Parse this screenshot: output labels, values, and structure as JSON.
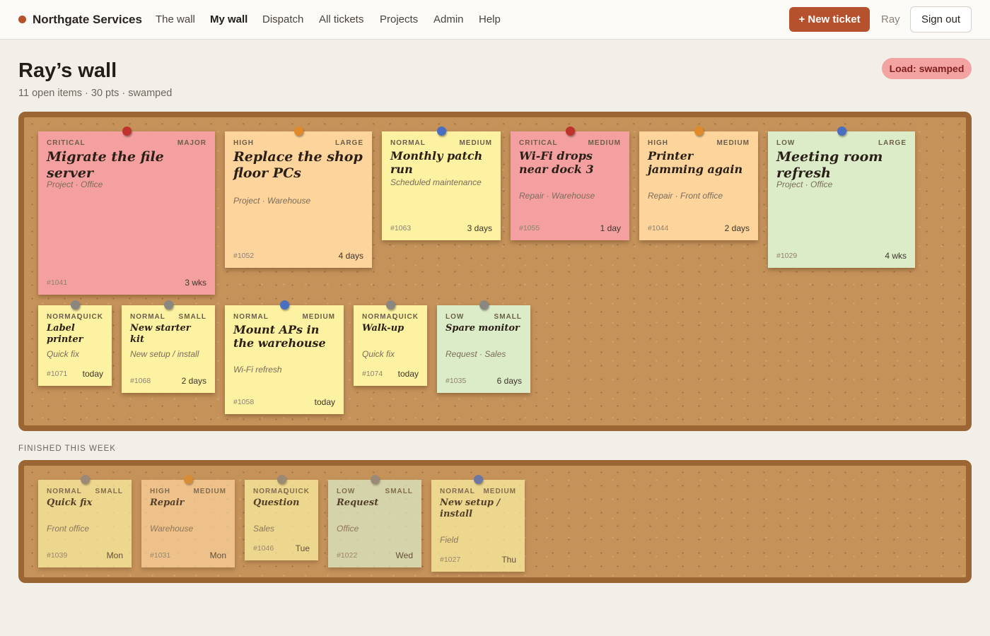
{
  "nav": {
    "brand": "Northgate Services",
    "links": [
      "The wall",
      "My wall",
      "Dispatch",
      "All tickets",
      "Projects",
      "Admin",
      "Help"
    ],
    "active": "My wall",
    "new_ticket": "+ New ticket",
    "user": "Ray",
    "sign_out": "Sign out"
  },
  "header": {
    "title": "Ray’s wall",
    "subtitle": "11 open items · 30 pts · swamped",
    "load_badge": "Load: swamped"
  },
  "colors": {
    "accent": "#b5512c",
    "red_note": "#f5a0a0",
    "orange_note": "#fdd49c",
    "yellow_note": "#fdf1a2",
    "green_note": "#dcecc8",
    "pin_red": "#c0322c",
    "pin_orange": "#e08a2a",
    "pin_blue": "#4a6fc0",
    "pin_gray": "#8a8780"
  },
  "open_notes": [
    {
      "priority": "CRITICAL",
      "size": "MAJOR",
      "title": "Migrate the file server",
      "meta": "Project · Office",
      "id": "#1041",
      "age": "3 wks"
    },
    {
      "priority": "HIGH",
      "size": "LARGE",
      "title": "Replace the shop floor PCs",
      "meta": "Project · Warehouse",
      "id": "#1052",
      "age": "4 days"
    },
    {
      "priority": "NORMAL",
      "size": "MEDIUM",
      "title": "Monthly patch run",
      "meta": "Scheduled maintenance",
      "id": "#1063",
      "age": "3 days"
    },
    {
      "priority": "CRITICAL",
      "size": "MEDIUM",
      "title": "Wi-Fi drops near dock 3",
      "meta": "Repair · Warehouse",
      "id": "#1055",
      "age": "1 day"
    },
    {
      "priority": "HIGH",
      "size": "MEDIUM",
      "title": "Printer jamming again",
      "meta": "Repair · Front office",
      "id": "#1044",
      "age": "2 days"
    },
    {
      "priority": "LOW",
      "size": "LARGE",
      "title": "Meeting room refresh",
      "meta": "Project · Office",
      "id": "#1029",
      "age": "4 wks"
    },
    {
      "priority": "NORMAL",
      "size": "QUICK",
      "title": "Label printer",
      "meta": "Quick fix",
      "id": "#1071",
      "age": "today"
    },
    {
      "priority": "NORMAL",
      "size": "SMALL",
      "title": "New starter kit",
      "meta": "New setup / install",
      "id": "#1068",
      "age": "2 days"
    },
    {
      "priority": "NORMAL",
      "size": "MEDIUM",
      "title": "Mount APs in the warehouse",
      "meta": "Wi-Fi refresh",
      "id": "#1058",
      "age": "today"
    },
    {
      "priority": "NORMAL",
      "size": "QUICK",
      "title": "Walk-up",
      "meta": "Quick fix",
      "id": "#1074",
      "age": "today"
    },
    {
      "priority": "LOW",
      "size": "SMALL",
      "title": "Spare monitor",
      "meta": "Request · Sales",
      "id": "#1035",
      "age": "6 days"
    }
  ],
  "finished": {
    "label": "FINISHED THIS WEEK",
    "notes": [
      {
        "priority": "NORMAL",
        "size": "SMALL",
        "title": "Quick fix",
        "meta": "Front office",
        "id": "#1039",
        "age": "Mon"
      },
      {
        "priority": "HIGH",
        "size": "MEDIUM",
        "title": "Repair",
        "meta": "Warehouse",
        "id": "#1031",
        "age": "Mon"
      },
      {
        "priority": "NORMAL",
        "size": "QUICK",
        "title": "Question",
        "meta": "Sales",
        "id": "#1046",
        "age": "Tue"
      },
      {
        "priority": "LOW",
        "size": "SMALL",
        "title": "Request",
        "meta": "Office",
        "id": "#1022",
        "age": "Wed"
      },
      {
        "priority": "NORMAL",
        "size": "MEDIUM",
        "title": "New setup / install",
        "meta": "Field",
        "id": "#1027",
        "age": "Thu"
      }
    ]
  }
}
